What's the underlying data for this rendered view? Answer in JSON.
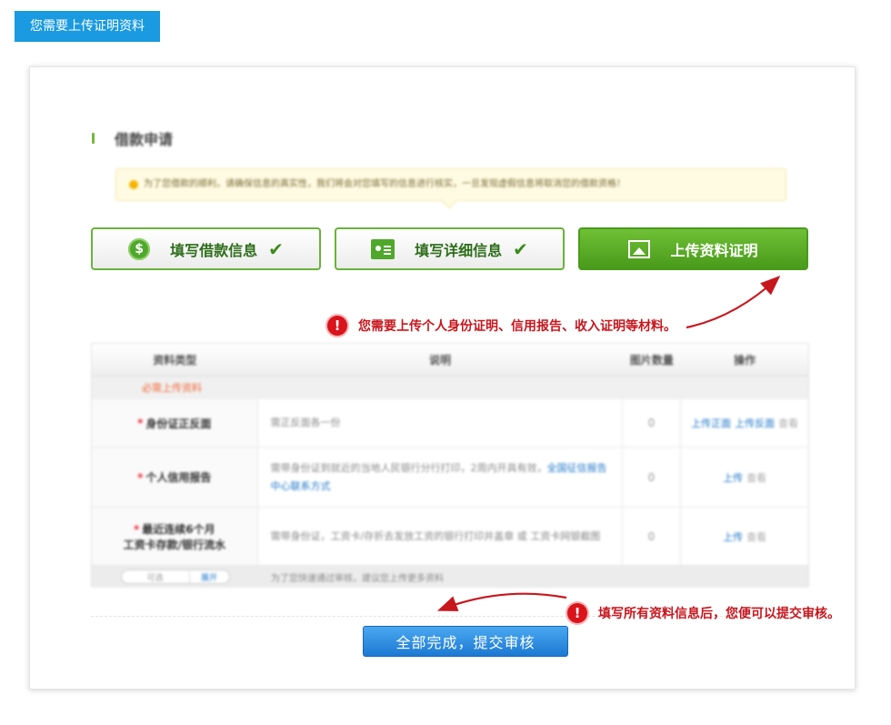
{
  "header": {
    "tab_label": "您需要上传证明资料"
  },
  "section": {
    "title": "借款申请"
  },
  "notice": {
    "text": "为了您借款的顺利，请确保信息的真实性，我们将会对您填写的信息进行核实，一旦发现虚假信息将取消您的借款资格！"
  },
  "steps": [
    {
      "label": "填写借款信息",
      "icon": "dollar-coin-icon",
      "done": true
    },
    {
      "label": "填写详细信息",
      "icon": "id-card-icon",
      "done": true
    },
    {
      "label": "上传资料证明",
      "icon": "image-icon",
      "done": false
    }
  ],
  "hints": {
    "upload": "您需要上传个人身份证明、信用报告、收入证明等材料。",
    "submit": "填写所有资料信息后，您便可以提交审核。"
  },
  "table": {
    "headers": [
      "资料类型",
      "说明",
      "图片数量",
      "操作"
    ],
    "group_label": "必需上传资料",
    "rows": [
      {
        "type": "身份证正反面",
        "desc": "需正反面各一份",
        "count": "0",
        "action_links": [
          "上传正面",
          "上传反面"
        ],
        "action_muted": "查看"
      },
      {
        "type": "个人信用报告",
        "desc": "需带身份证到就近的当地人民银行分行打印，2周内开具有效，",
        "desc_link": "全国征信报告中心联系方式",
        "count": "0",
        "action_links": [
          "上传"
        ],
        "action_muted": "查看"
      },
      {
        "type": "最近连续6个月",
        "type_line2": "工资卡存款/银行流水",
        "desc": "需带身份证，工资卡/存折去发放工资的银行打印并盖章 或 工资卡网银截图",
        "count": "0",
        "action_links": [
          "上传"
        ],
        "action_muted": "查看"
      }
    ],
    "footer": {
      "optional_label": "可选",
      "expand_label": "展开",
      "note": "为了您快速通过审核，建议您上传更多资料"
    }
  },
  "submit": {
    "label": "全部完成，提交审核"
  },
  "colors": {
    "accent_blue": "#1a9ae0",
    "step_green": "#4a9a1c",
    "hint_red": "#c8161d"
  }
}
